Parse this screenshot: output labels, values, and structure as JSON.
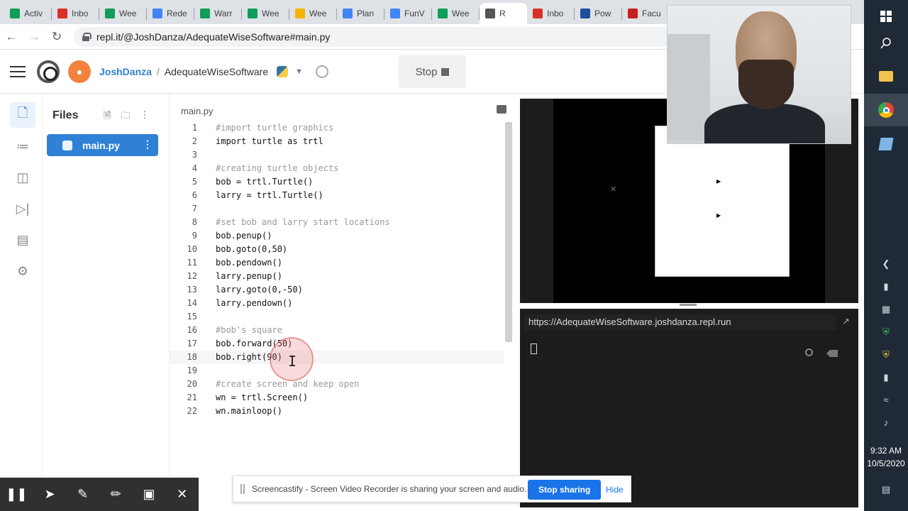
{
  "browser": {
    "tabs": [
      {
        "label": "Activ",
        "favicon_color": "#0f9d58",
        "active": false
      },
      {
        "label": "Inbo",
        "favicon_color": "#d93025",
        "active": false
      },
      {
        "label": "Wee",
        "favicon_color": "#0f9d58",
        "active": false
      },
      {
        "label": "Rede",
        "favicon_color": "#4285f4",
        "active": false
      },
      {
        "label": "Warr",
        "favicon_color": "#0f9d58",
        "active": false
      },
      {
        "label": "Wee",
        "favicon_color": "#0f9d58",
        "active": false
      },
      {
        "label": "Wee",
        "favicon_color": "#f4b400",
        "active": false
      },
      {
        "label": "Plan",
        "favicon_color": "#4285f4",
        "active": false
      },
      {
        "label": "FunV",
        "favicon_color": "#4285f4",
        "active": false
      },
      {
        "label": "Wee",
        "favicon_color": "#0f9d58",
        "active": false
      },
      {
        "label": "R",
        "favicon_color": "#555555",
        "active": true
      },
      {
        "label": "Inbo",
        "favicon_color": "#d93025",
        "active": false
      },
      {
        "label": "Pow",
        "favicon_color": "#1e4e9c",
        "active": false
      },
      {
        "label": "Facu",
        "favicon_color": "#c5221f",
        "active": false
      }
    ],
    "url": "repl.it/@JoshDanza/AdequateWiseSoftware#main.py"
  },
  "header": {
    "username": "JoshDanza",
    "separator": "/",
    "project": "AdequateWiseSoftware",
    "stop_label": "Stop"
  },
  "files_panel": {
    "title": "Files",
    "file": "main.py"
  },
  "editor": {
    "tab": "main.py",
    "lines": [
      {
        "num": "1",
        "code": "#import turtle graphics",
        "comment": true
      },
      {
        "num": "2",
        "code": "import turtle as trtl",
        "comment": false
      },
      {
        "num": "3",
        "code": "",
        "comment": false
      },
      {
        "num": "4",
        "code": "#creating turtle objects",
        "comment": true
      },
      {
        "num": "5",
        "code": "bob = trtl.Turtle()",
        "comment": false
      },
      {
        "num": "6",
        "code": "larry = trtl.Turtle()",
        "comment": false
      },
      {
        "num": "7",
        "code": "",
        "comment": false
      },
      {
        "num": "8",
        "code": "#set bob and larry start locations",
        "comment": true
      },
      {
        "num": "9",
        "code": "bob.penup()",
        "comment": false
      },
      {
        "num": "10",
        "code": "bob.goto(0,50)",
        "comment": false
      },
      {
        "num": "11",
        "code": "bob.pendown()",
        "comment": false
      },
      {
        "num": "12",
        "code": "larry.penup()",
        "comment": false
      },
      {
        "num": "13",
        "code": "larry.goto(0,-50)",
        "comment": false
      },
      {
        "num": "14",
        "code": "larry.pendown()",
        "comment": false
      },
      {
        "num": "15",
        "code": "",
        "comment": false
      },
      {
        "num": "16",
        "code": "#bob's square",
        "comment": true
      },
      {
        "num": "17",
        "code": "bob.forward(50)",
        "comment": false
      },
      {
        "num": "18",
        "code": "bob.right(90)",
        "comment": false
      },
      {
        "num": "19",
        "code": "",
        "comment": false
      },
      {
        "num": "20",
        "code": "#create screen and keep open",
        "comment": true
      },
      {
        "num": "21",
        "code": "wn = trtl.Screen()",
        "comment": false
      },
      {
        "num": "22",
        "code": "wn.mainloop()",
        "comment": false
      }
    ],
    "current_line": 18
  },
  "output": {
    "webview_url": "https://AdequateWiseSoftware.joshdanza.repl.run"
  },
  "screencastify": {
    "notice": "Screencastify - Screen Video Recorder is sharing your screen and audio.",
    "stop_sharing": "Stop sharing",
    "hide": "Hide"
  },
  "taskbar": {
    "time": "9:32 AM",
    "date": "10/5/2020"
  }
}
